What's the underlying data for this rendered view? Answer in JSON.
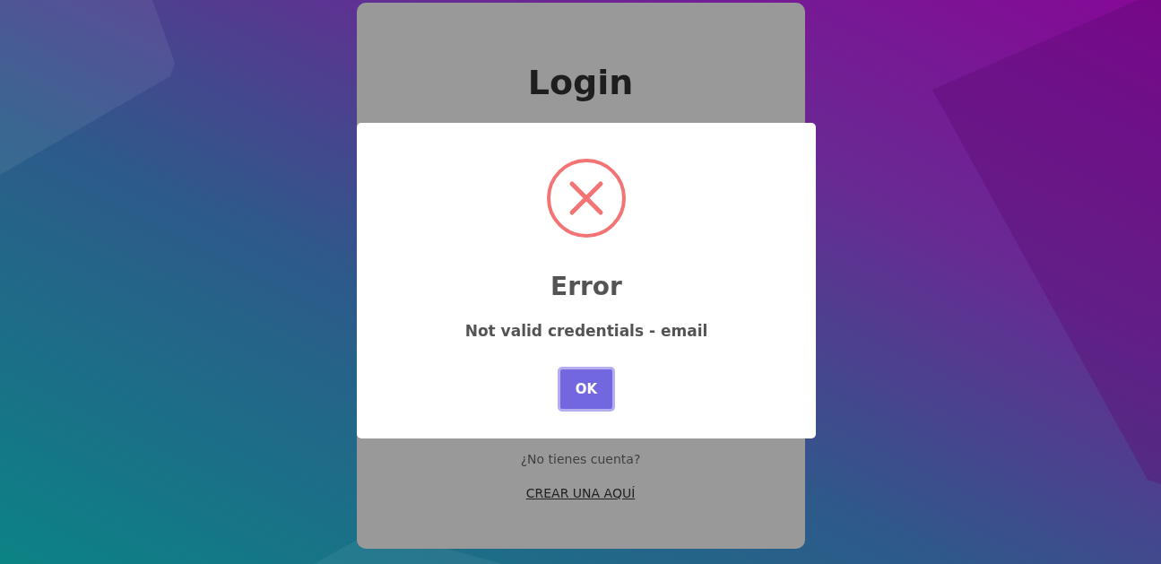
{
  "login_card": {
    "title": "Login",
    "signup_prompt": "¿No tienes cuenta?",
    "signup_link": "CREAR UNA AQUÍ"
  },
  "dialog": {
    "kind": "error",
    "title": "Error",
    "message": "Not valid credentials - email",
    "button": "OK"
  }
}
